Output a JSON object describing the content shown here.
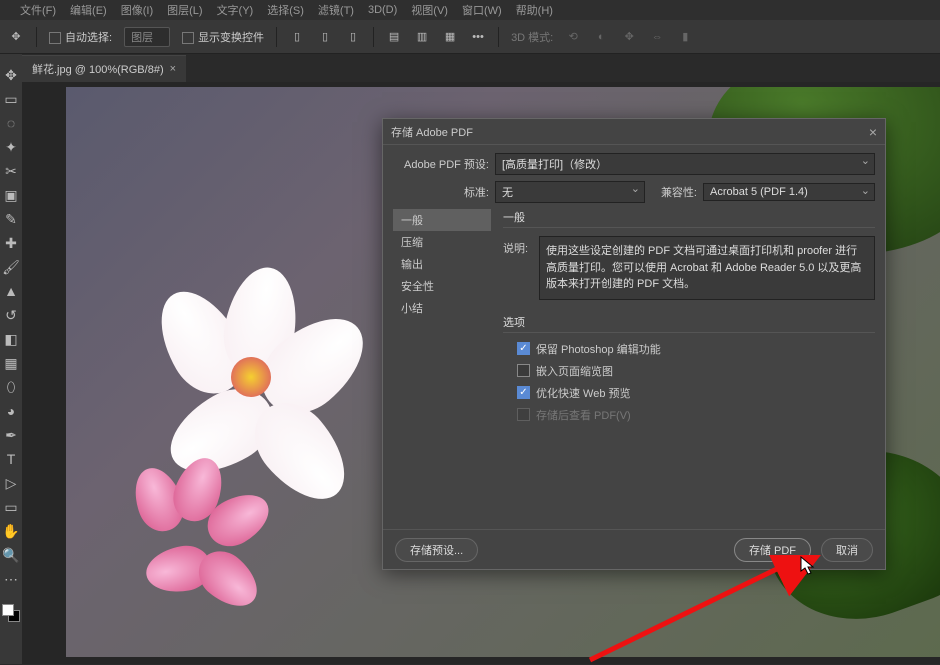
{
  "menubar": [
    "文件(F)",
    "编辑(E)",
    "图像(I)",
    "图层(L)",
    "文字(Y)",
    "选择(S)",
    "滤镜(T)",
    "3D(D)",
    "视图(V)",
    "窗口(W)",
    "帮助(H)"
  ],
  "optbar": {
    "auto_select_label": "自动选择:",
    "layer_select": "图层",
    "show_transform": "显示变换控件",
    "mode3d_label": "3D 模式:"
  },
  "tab": {
    "title": "鲜花.jpg @ 100%(RGB/8#)"
  },
  "dialog": {
    "title": "存储 Adobe PDF",
    "preset_label": "Adobe PDF 预设:",
    "preset_value": "[高质量打印]（修改）",
    "standard_label": "标准:",
    "standard_value": "无",
    "compat_label": "兼容性:",
    "compat_value": "Acrobat 5 (PDF 1.4)",
    "sidenav": [
      "一般",
      "压缩",
      "输出",
      "安全性",
      "小结"
    ],
    "panel_title": "一般",
    "desc_label": "说明:",
    "desc_text": "使用这些设定创建的 PDF 文档可通过桌面打印机和 proofer 进行高质量打印。您可以使用 Acrobat 和 Adobe Reader 5.0 以及更高版本来打开创建的 PDF 文档。",
    "options_label": "选项",
    "opts": [
      {
        "label": "保留 Photoshop 编辑功能",
        "checked": true,
        "disabled": false
      },
      {
        "label": "嵌入页面缩览图",
        "checked": false,
        "disabled": false
      },
      {
        "label": "优化快速 Web 预览",
        "checked": true,
        "disabled": false
      },
      {
        "label": "存储后查看 PDF(V)",
        "checked": false,
        "disabled": true
      }
    ],
    "save_preset_btn": "存储预设...",
    "save_btn": "存储 PDF",
    "cancel_btn": "取消"
  }
}
